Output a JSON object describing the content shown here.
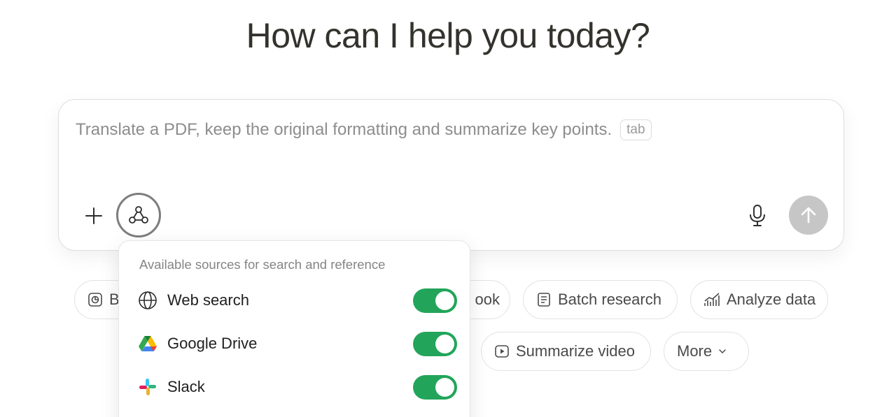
{
  "heading": "How can I help you today?",
  "composer": {
    "placeholder": "Translate a PDF, keep the original formatting and summarize key points.",
    "tab_hint": "tab"
  },
  "icons": {
    "add": "plus-icon",
    "connectors": "connectors-icon",
    "mic": "microphone-icon",
    "send": "arrow-up-icon"
  },
  "chips": {
    "build_partial": "Bu",
    "playbook_partial": "ook",
    "batch_research": "Batch research",
    "analyze_data": "Analyze data",
    "summarize_video": "Summarize video",
    "more": "More"
  },
  "sources_menu": {
    "heading": "Available sources for search and reference",
    "items": [
      {
        "label": "Web search",
        "icon": "globe-icon",
        "enabled": true
      },
      {
        "label": "Google Drive",
        "icon": "google-drive-icon",
        "enabled": true
      },
      {
        "label": "Slack",
        "icon": "slack-icon",
        "enabled": true
      }
    ]
  },
  "colors": {
    "toggle_on": "#22a55a",
    "send_disabled": "#c6c6c6",
    "heading": "#34322d",
    "placeholder": "#8d8d8d"
  }
}
